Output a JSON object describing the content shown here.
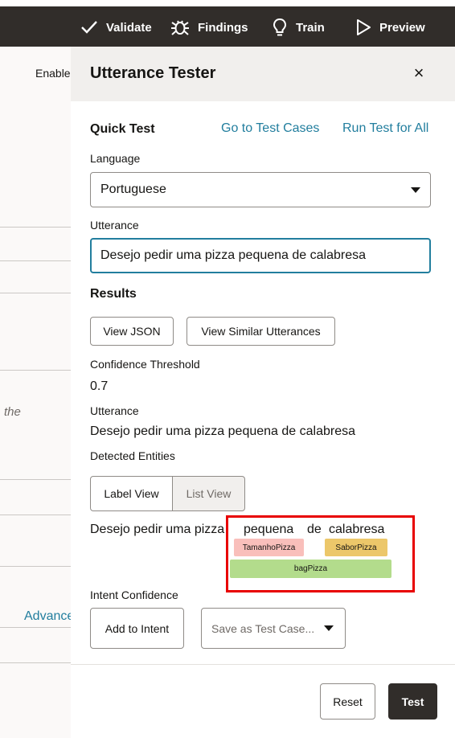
{
  "topbar": {
    "items": [
      {
        "label": "Validate",
        "icon": "check-icon"
      },
      {
        "label": "Findings",
        "icon": "bug-icon"
      },
      {
        "label": "Train",
        "icon": "lightbulb-icon"
      },
      {
        "label": "Preview",
        "icon": "play-icon"
      }
    ]
  },
  "background": {
    "enable_text": "Enable",
    "partial_text": "the",
    "advanced_link": "Advance"
  },
  "drawer": {
    "title": "Utterance Tester",
    "close_icon": "close-icon",
    "quick_test": {
      "heading": "Quick Test",
      "go_to_test_cases": "Go to Test Cases",
      "run_test_for_all": "Run Test for All",
      "language_label": "Language",
      "language_value": "Portuguese",
      "utterance_label": "Utterance",
      "utterance_value": "Desejo pedir uma pizza pequena de calabresa"
    },
    "results": {
      "heading": "Results",
      "view_json": "View JSON",
      "view_similar": "View Similar Utterances",
      "confidence_threshold_label": "Confidence Threshold",
      "confidence_threshold_value": "0.7",
      "utterance_label": "Utterance",
      "utterance_value": "Desejo pedir uma pizza pequena de calabresa",
      "detected_entities_label": "Detected Entities",
      "label_view": "Label View",
      "list_view": "List View",
      "entity_sentence_prefix": "Desejo pedir uma pizza",
      "tokens": [
        "pequena",
        "de",
        "calabresa"
      ],
      "entities": {
        "tamanho": "TamanhoPizza",
        "sabor": "SaborPizza",
        "bag": "bagPizza"
      },
      "entity_colors": {
        "tamanho": "#f9bfbb",
        "sabor": "#ecc76a",
        "bag": "#b3dc8c"
      },
      "intent_confidence_label": "Intent Confidence",
      "add_to_intent": "Add to Intent",
      "save_as_test_case": "Save as Test Case..."
    },
    "footer": {
      "reset": "Reset",
      "test": "Test"
    }
  }
}
